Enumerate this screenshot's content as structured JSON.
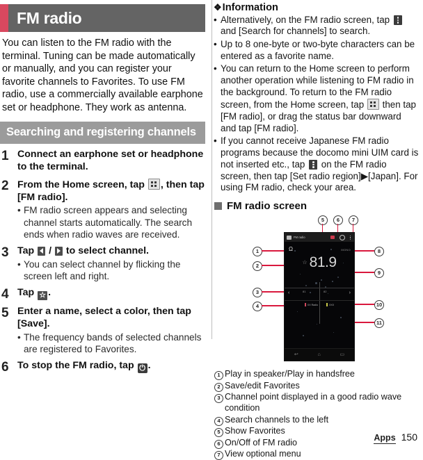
{
  "chapter": {
    "title": "FM radio"
  },
  "intro": "You can listen to the FM radio with the terminal. Tuning can be made automatically or manually, and you can register your favorite channels to Favorites. To use FM radio, use a commercially available earphone set or headphone. They work as antenna.",
  "section": {
    "title": "Searching and registering channels"
  },
  "steps": [
    {
      "num": "1",
      "title_parts": [
        "Connect an earphone set or headphone to the terminal."
      ],
      "subs": []
    },
    {
      "num": "2",
      "title_pre": "From the Home screen, tap ",
      "title_post": ", then tap [FM radio].",
      "subs": [
        "FM radio screen appears and selecting channel starts automatically. The search ends when radio waves are received."
      ]
    },
    {
      "num": "3",
      "title_pre": "Tap ",
      "title_mid": " / ",
      "title_post": " to select channel.",
      "subs": [
        "You can select channel by flicking the screen left and right."
      ]
    },
    {
      "num": "4",
      "title_pre": "Tap ",
      "title_post": ".",
      "subs": []
    },
    {
      "num": "5",
      "title_parts": [
        "Enter a name, select a color, then tap [Save]."
      ],
      "subs": [
        "The frequency bands of selected channels are registered to Favorites."
      ]
    },
    {
      "num": "6",
      "title_pre": "To stop the FM radio, tap ",
      "title_post": ".",
      "subs": []
    }
  ],
  "information": {
    "heading": "Information",
    "diamond": "❖",
    "bullets": [
      {
        "pre": "Alternatively, on the FM radio screen, tap ",
        "post": " and [Search for channels] to search."
      },
      {
        "pre": "Up to 8 one-byte or two-byte characters can be entered as a favorite name.",
        "post": ""
      },
      {
        "pre": "You can return to the Home screen to perform another operation while listening to FM radio in the background. To return to the FM radio screen, from the Home screen, tap ",
        "post": " then tap [FM radio], or drag the status bar downward and tap [FM radio]."
      },
      {
        "pre": "If you cannot receive Japanese FM radio programs because the docomo mini UIM card is not inserted etc., tap ",
        "post": " on the FM radio screen, then tap [Set radio region]▶[Japan]. For using FM radio, check your area."
      }
    ]
  },
  "screen_section": {
    "title": "FM radio screen"
  },
  "phone": {
    "app_title": "FM radio",
    "mono_label": "MONO",
    "frequency": "81.9",
    "star": "☆",
    "headphone": "Ω",
    "tick_left": "81",
    "tick_right": "82",
    "nav_left": "‹",
    "nav_right": "›",
    "favorites": [
      {
        "label": "XX Radio",
        "color": "#d04a5e"
      },
      {
        "label": "XXX",
        "color": "#c8c84a"
      }
    ],
    "nav_back": "↩",
    "nav_home": "⌂",
    "nav_recent": "▭"
  },
  "callouts": [
    "1",
    "2",
    "3",
    "4",
    "5",
    "6",
    "7",
    "8",
    "9",
    "10",
    "11"
  ],
  "legend": [
    {
      "num": "1",
      "text": "Play in speaker/Play in handsfree"
    },
    {
      "num": "2",
      "text": "Save/edit Favorites"
    },
    {
      "num": "3",
      "text": "Channel point displayed in a good radio wave condition"
    },
    {
      "num": "4",
      "text": "Search channels to the left"
    },
    {
      "num": "5",
      "text": "Show Favorites"
    },
    {
      "num": "6",
      "text": "On/Off of FM radio"
    },
    {
      "num": "7",
      "text": "View optional menu"
    }
  ],
  "footer": {
    "apps": "Apps",
    "page": "150"
  },
  "colors": {
    "accent": "#d9485f",
    "header_gray": "#646464",
    "section_gray": "#9b9b9b",
    "callout_red": "#d9183d"
  }
}
